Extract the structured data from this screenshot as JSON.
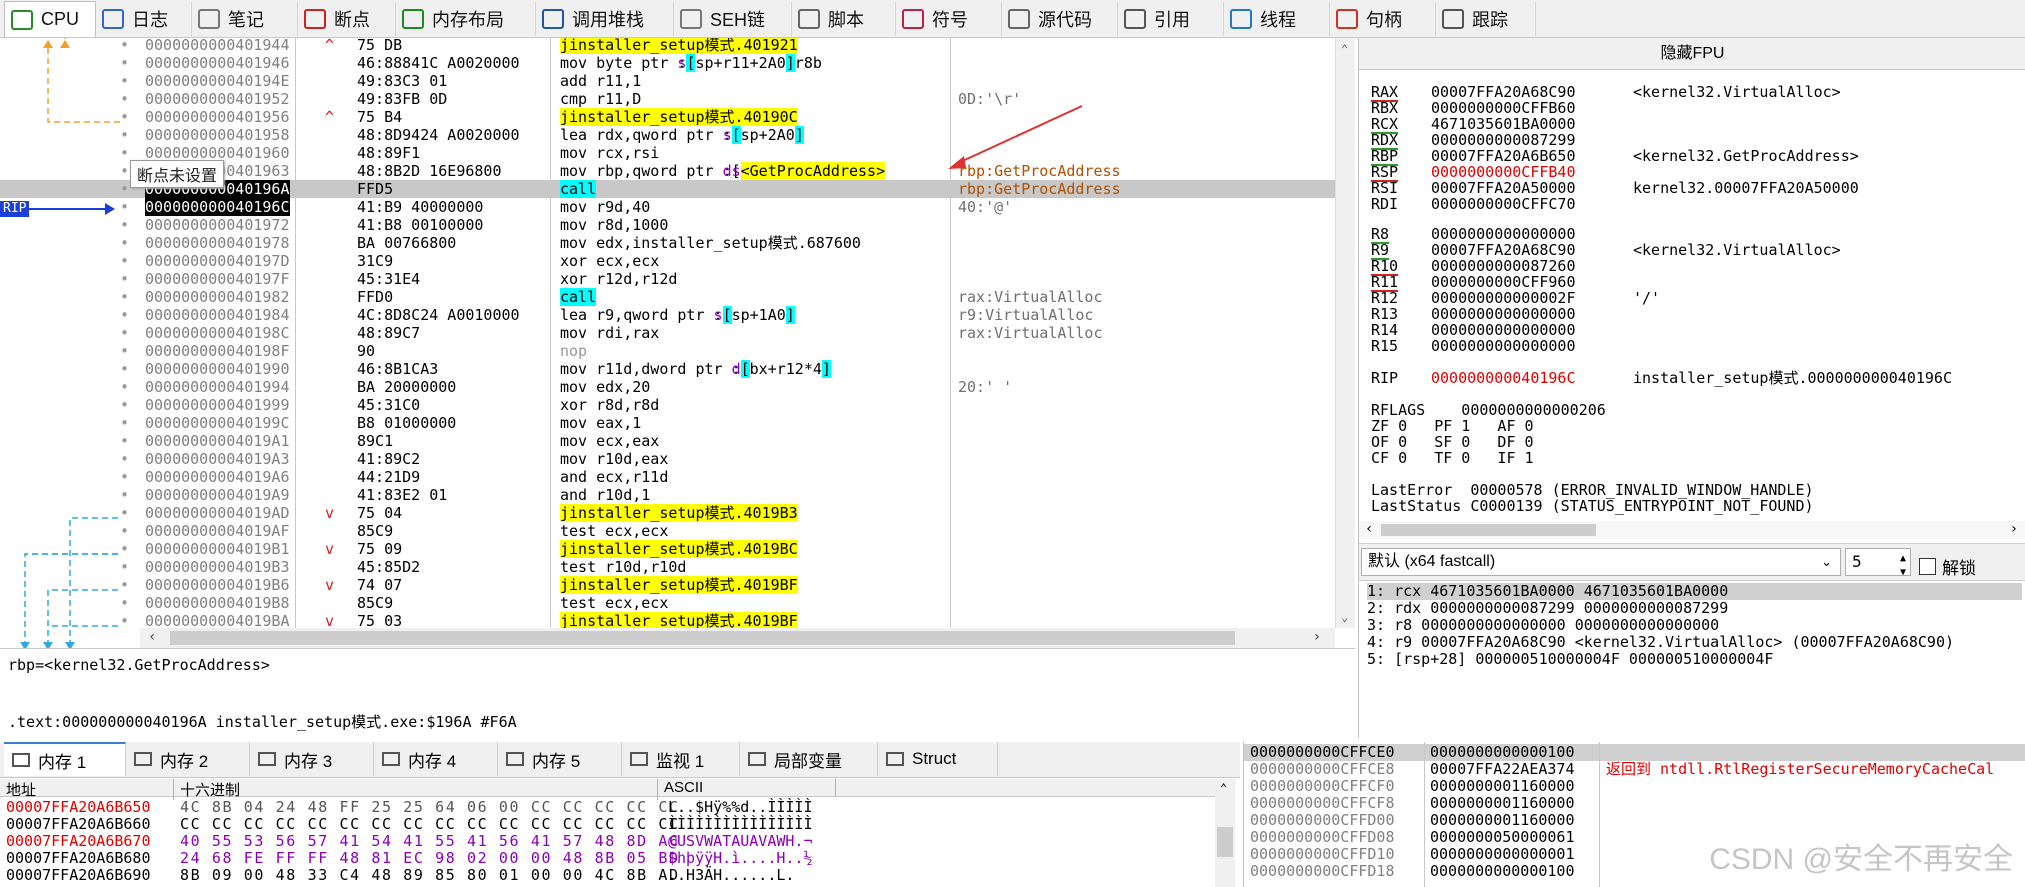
{
  "tabs": [
    {
      "label": "CPU",
      "icon": "cpu-icon"
    },
    {
      "label": "日志",
      "icon": "log-icon"
    },
    {
      "label": "笔记",
      "icon": "notes-icon"
    },
    {
      "label": "断点",
      "icon": "breakpoint-icon"
    },
    {
      "label": "内存布局",
      "icon": "memory-map-icon"
    },
    {
      "label": "调用堆栈",
      "icon": "callstack-icon"
    },
    {
      "label": "SEH链",
      "icon": "seh-icon"
    },
    {
      "label": "脚本",
      "icon": "script-icon"
    },
    {
      "label": "符号",
      "icon": "symbol-icon"
    },
    {
      "label": "源代码",
      "icon": "source-icon"
    },
    {
      "label": "引用",
      "icon": "references-icon"
    },
    {
      "label": "线程",
      "icon": "threads-icon"
    },
    {
      "label": "句柄",
      "icon": "handles-icon"
    },
    {
      "label": "跟踪",
      "icon": "trace-icon"
    }
  ],
  "disasm": {
    "tooltip": "断点未设置",
    "rip_label": "RIP",
    "rows": [
      {
        "addr": "0000000000401944",
        "mark": "^",
        "bytes": "75 DB",
        "ins": "jne installer_setup模式.401921",
        "cmt": ""
      },
      {
        "addr": "0000000000401946",
        "mark": "",
        "bytes": "46:88841C A0020000",
        "ins": "mov byte ptr ss:[rsp+r11+2A0],r8b",
        "cmt": ""
      },
      {
        "addr": "000000000040194E",
        "mark": "",
        "bytes": "49:83C3 01",
        "ins": "add r11,1",
        "cmt": ""
      },
      {
        "addr": "0000000000401952",
        "mark": "",
        "bytes": "49:83FB 0D",
        "ins": "cmp r11,D",
        "cmt": "0D:'\\r'"
      },
      {
        "addr": "0000000000401956",
        "mark": "^",
        "bytes": "75 B4",
        "ins": "jne installer_setup模式.40190C",
        "cmt": ""
      },
      {
        "addr": "0000000000401958",
        "mark": "",
        "bytes": "48:8D9424 A0020000",
        "ins": "lea rdx,qword ptr ss:[rsp+2A0]",
        "cmt": ""
      },
      {
        "addr": "0000000000401960",
        "mark": "",
        "bytes": "48:89F1",
        "ins": "mov rcx,rsi",
        "cmt": ""
      },
      {
        "addr": "0000000000401963",
        "mark": "",
        "bytes": "48:8B2D 16E96800",
        "ins": "mov rbp,qword ptr ds:[<GetProcAddress>]",
        "cmt": "rbp:GetProcAddress"
      },
      {
        "addr": "000000000040196A",
        "mark": "",
        "bytes": "FFD5",
        "ins": "call rbp",
        "cmt": "rbp:GetProcAddress"
      },
      {
        "addr": "000000000040196C",
        "mark": "",
        "bytes": "41:B9 40000000",
        "ins": "mov r9d,40",
        "cmt": "40:'@'"
      },
      {
        "addr": "0000000000401972",
        "mark": "",
        "bytes": "41:B8 00100000",
        "ins": "mov r8d,1000",
        "cmt": ""
      },
      {
        "addr": "0000000000401978",
        "mark": "",
        "bytes": "BA 00766800",
        "ins": "mov edx,installer_setup模式.687600",
        "cmt": ""
      },
      {
        "addr": "000000000040197D",
        "mark": "",
        "bytes": "31C9",
        "ins": "xor ecx,ecx",
        "cmt": ""
      },
      {
        "addr": "000000000040197F",
        "mark": "",
        "bytes": "45:31E4",
        "ins": "xor r12d,r12d",
        "cmt": ""
      },
      {
        "addr": "0000000000401982",
        "mark": "",
        "bytes": "FFD0",
        "ins": "call rax",
        "cmt": "rax:VirtualAlloc"
      },
      {
        "addr": "0000000000401984",
        "mark": "",
        "bytes": "4C:8D8C24 A0010000",
        "ins": "lea r9,qword ptr ss:[rsp+1A0]",
        "cmt": "r9:VirtualAlloc"
      },
      {
        "addr": "000000000040198C",
        "mark": "",
        "bytes": "48:89C7",
        "ins": "mov rdi,rax",
        "cmt": "rax:VirtualAlloc"
      },
      {
        "addr": "000000000040198F",
        "mark": "",
        "bytes": "90",
        "ins": "nop",
        "cmt": ""
      },
      {
        "addr": "0000000000401990",
        "mark": "",
        "bytes": "46:8B1CA3",
        "ins": "mov r11d,dword ptr ds:[rbx+r12*4]",
        "cmt": ""
      },
      {
        "addr": "0000000000401994",
        "mark": "",
        "bytes": "BA 20000000",
        "ins": "mov edx,20",
        "cmt": "20:' '"
      },
      {
        "addr": "0000000000401999",
        "mark": "",
        "bytes": "45:31C0",
        "ins": "xor r8d,r8d",
        "cmt": ""
      },
      {
        "addr": "000000000040199C",
        "mark": "",
        "bytes": "B8 01000000",
        "ins": "mov eax,1",
        "cmt": ""
      },
      {
        "addr": "00000000004019A1",
        "mark": "",
        "bytes": "89C1",
        "ins": "mov ecx,eax",
        "cmt": ""
      },
      {
        "addr": "00000000004019A3",
        "mark": "",
        "bytes": "41:89C2",
        "ins": "mov r10d,eax",
        "cmt": ""
      },
      {
        "addr": "00000000004019A6",
        "mark": "",
        "bytes": "44:21D9",
        "ins": "and ecx,r11d",
        "cmt": ""
      },
      {
        "addr": "00000000004019A9",
        "mark": "",
        "bytes": "41:83E2 01",
        "ins": "and r10d,1",
        "cmt": ""
      },
      {
        "addr": "00000000004019AD",
        "mark": "v",
        "bytes": "75 04",
        "ins": "jne installer_setup模式.4019B3",
        "cmt": ""
      },
      {
        "addr": "00000000004019AF",
        "mark": "",
        "bytes": "85C9",
        "ins": "test ecx,ecx",
        "cmt": ""
      },
      {
        "addr": "00000000004019B1",
        "mark": "v",
        "bytes": "75 09",
        "ins": "jne installer_setup模式.4019BC",
        "cmt": ""
      },
      {
        "addr": "00000000004019B3",
        "mark": "",
        "bytes": "45:85D2",
        "ins": "test r10d,r10d",
        "cmt": ""
      },
      {
        "addr": "00000000004019B6",
        "mark": "v",
        "bytes": "74 07",
        "ins": "je installer_setup模式.4019BF",
        "cmt": ""
      },
      {
        "addr": "00000000004019B8",
        "mark": "",
        "bytes": "85C9",
        "ins": "test ecx,ecx",
        "cmt": ""
      },
      {
        "addr": "00000000004019BA",
        "mark": "v",
        "bytes": "75 03",
        "ins": "jne installer_setup模式.4019BF",
        "cmt": ""
      }
    ]
  },
  "info_line1": "rbp=<kernel32.GetProcAddress>",
  "info_line2": ".text:000000000040196A installer_setup模式.exe:$196A #F6A",
  "regs": {
    "title": "隐藏FPU",
    "gp": [
      {
        "n": "RAX",
        "v": "00007FFA20A68C90",
        "c": "<kernel32.VirtualAlloc>"
      },
      {
        "n": "RBX",
        "v": "0000000000CFFB60",
        "c": ""
      },
      {
        "n": "RCX",
        "v": "4671035601BA0000",
        "c": ""
      },
      {
        "n": "RDX",
        "v": "0000000000087299",
        "c": ""
      },
      {
        "n": "RBP",
        "v": "00007FFA20A6B650",
        "c": "<kernel32.GetProcAddress>"
      },
      {
        "n": "RSP",
        "v": "0000000000CFFB40",
        "c": ""
      },
      {
        "n": "RSI",
        "v": "00007FFA20A50000",
        "c": "kernel32.00007FFA20A50000"
      },
      {
        "n": "RDI",
        "v": "0000000000CFFC70",
        "c": ""
      }
    ],
    "ext": [
      {
        "n": "R8",
        "v": "0000000000000000",
        "c": ""
      },
      {
        "n": "R9",
        "v": "00007FFA20A68C90",
        "c": "<kernel32.VirtualAlloc>"
      },
      {
        "n": "R10",
        "v": "0000000000087260",
        "c": ""
      },
      {
        "n": "R11",
        "v": "0000000000CFF960",
        "c": ""
      },
      {
        "n": "R12",
        "v": "000000000000002F",
        "c": "'/'"
      },
      {
        "n": "R13",
        "v": "0000000000000000",
        "c": ""
      },
      {
        "n": "R14",
        "v": "0000000000000000",
        "c": ""
      },
      {
        "n": "R15",
        "v": "0000000000000000",
        "c": ""
      }
    ],
    "rip": {
      "n": "RIP",
      "v": "000000000040196C",
      "c": "installer_setup模式.000000000040196C"
    },
    "rflags": "RFLAGS    0000000000000206",
    "flags": [
      "ZF 0   PF 1   AF 0",
      "OF 0   SF 0   DF 0",
      "CF 0   TF 0   IF 1"
    ],
    "last_error": "LastError  00000578 (ERROR_INVALID_WINDOW_HANDLE)",
    "last_status": "LastStatus C0000139 (STATUS_ENTRYPOINT_NOT_FOUND)"
  },
  "callconv": {
    "select": "默认 (x64 fastcall)",
    "count": "5",
    "unlock": "解锁"
  },
  "args": [
    "1: rcx 4671035601BA0000 4671035601BA0000",
    "2: rdx 0000000000087299 0000000000087299",
    "3: r8 0000000000000000 0000000000000000",
    "4: r9 00007FFA20A68C90 <kernel32.VirtualAlloc> (00007FFA20A68C90)",
    "5: [rsp+28] 000000510000004F 000000510000004F"
  ],
  "bottom_tabs": [
    {
      "label": "内存 1",
      "icon": "memory-icon"
    },
    {
      "label": "内存 2",
      "icon": "memory-icon"
    },
    {
      "label": "内存 3",
      "icon": "memory-icon"
    },
    {
      "label": "内存 4",
      "icon": "memory-icon"
    },
    {
      "label": "内存 5",
      "icon": "memory-icon"
    },
    {
      "label": "监视 1",
      "icon": "watch-icon"
    },
    {
      "label": "局部变量",
      "icon": "locals-icon"
    },
    {
      "label": "Struct",
      "icon": "struct-icon"
    }
  ],
  "dump": {
    "headers": [
      "地址",
      "十六进制",
      "ASCII"
    ],
    "rows": [
      {
        "addr": "00007FFA20A6B650",
        "hex": "4C 8B 04 24 48 FF 25 25 64 06 00 CC CC CC CC CC",
        "ascii": "L..$Hÿ%%d..ÌÌÌÌÌ"
      },
      {
        "addr": "00007FFA20A6B660",
        "hex": "CC CC CC CC CC CC CC CC CC CC CC CC CC CC CC CC",
        "ascii": "ÌÌÌÌÌÌÌÌÌÌÌÌÌÌÌÌ"
      },
      {
        "addr": "00007FFA20A6B670",
        "hex": "40 55 53 56 57 41 54 41 55 41 56 41 57 48 8D AC",
        "ascii": "@USVWATAUAVAWH.¬"
      },
      {
        "addr": "00007FFA20A6B680",
        "hex": "24 68 FE FF FF 48 81 EC 98 02 00 00 48 8B 05 BD",
        "ascii": "$hþÿÿH.ì....H..½"
      },
      {
        "addr": "00007FFA20A6B690",
        "hex": "8B 09 00 48 33 C4 48 89 85 80 01 00 00 4C 8B AD",
        "ascii": "..H3ÄH......L.­"
      }
    ]
  },
  "stack": {
    "rows": [
      {
        "addr": "0000000000CFFCE0",
        "val": "0000000000000100",
        "cmt": ""
      },
      {
        "addr": "0000000000CFFCE8",
        "val": "00007FFA22AEA374",
        "cmt": "返回到 ntdll.RtlRegisterSecureMemoryCacheCal"
      },
      {
        "addr": "0000000000CFFCF0",
        "val": "0000000001160000",
        "cmt": ""
      },
      {
        "addr": "0000000000CFFCF8",
        "val": "0000000001160000",
        "cmt": ""
      },
      {
        "addr": "0000000000CFFD00",
        "val": "0000000001160000",
        "cmt": ""
      },
      {
        "addr": "0000000000CFFD08",
        "val": "0000000050000061",
        "cmt": ""
      },
      {
        "addr": "0000000000CFFD10",
        "val": "0000000000000001",
        "cmt": ""
      },
      {
        "addr": "0000000000CFFD18",
        "val": "0000000000000100",
        "cmt": ""
      }
    ]
  },
  "watermark": "CSDN @安全不再安全",
  "colors": {
    "yellow": "#ffff00",
    "cyan": "#00ffff",
    "rip_blue": "#1c3fd6",
    "red": "#e00000",
    "arrow_red": "#e03030"
  }
}
